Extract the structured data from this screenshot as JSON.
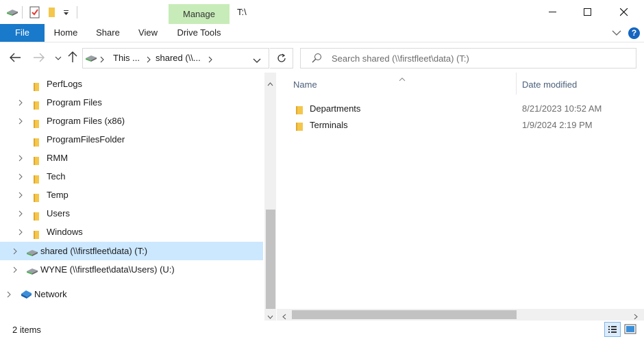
{
  "window": {
    "title": "T:\\",
    "contextual_tab": "Manage",
    "contextual_subtab": "Drive Tools"
  },
  "ribbon": {
    "tabs": [
      "File",
      "Home",
      "Share",
      "View"
    ]
  },
  "address": {
    "crumb1": "This ...",
    "crumb2": "shared (\\\\...",
    "search_placeholder": "Search shared (\\\\firstfleet\\data) (T:)"
  },
  "nav": {
    "items": [
      {
        "label": "PerfLogs",
        "chevron": false
      },
      {
        "label": "Program Files",
        "chevron": true
      },
      {
        "label": "Program Files (x86)",
        "chevron": true
      },
      {
        "label": "ProgramFilesFolder",
        "chevron": false
      },
      {
        "label": "RMM",
        "chevron": true
      },
      {
        "label": "Tech",
        "chevron": true
      },
      {
        "label": "Temp",
        "chevron": true
      },
      {
        "label": "Users",
        "chevron": true
      },
      {
        "label": "Windows",
        "chevron": true
      }
    ],
    "drives": [
      {
        "label": "shared (\\\\firstfleet\\data) (T:)",
        "selected": true
      },
      {
        "label": "WYNE (\\\\firstfleet\\data\\Users) (U:)",
        "selected": false
      }
    ],
    "network": "Network"
  },
  "columns": {
    "name": "Name",
    "date": "Date modified"
  },
  "files": [
    {
      "name": "Departments",
      "date": "8/21/2023 10:52 AM"
    },
    {
      "name": "Terminals",
      "date": "1/9/2024 2:19 PM"
    }
  ],
  "status": {
    "count": "2 items"
  },
  "colors": {
    "accent": "#1979ca",
    "selection": "#cce8ff",
    "manage_tab": "#c8ecb9",
    "folder": "#f4c64b"
  }
}
